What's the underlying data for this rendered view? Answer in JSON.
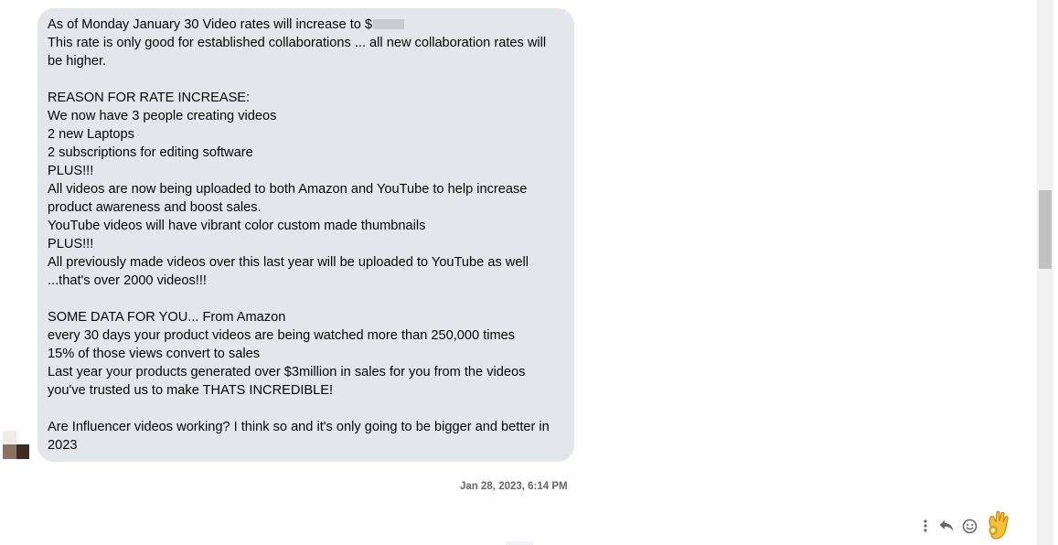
{
  "message": {
    "rate_intro": "As of Monday January 30 Video rates will increase to $",
    "lines": [
      "This rate is only good for established collaborations ... all new collaboration rates will be higher.",
      "",
      "REASON FOR RATE INCREASE:",
      "We now have 3 people creating videos",
      "2 new Laptops",
      "2 subscriptions for editing software",
      "PLUS!!!",
      "All videos are now being uploaded to both Amazon and YouTube to help increase product awareness and boost sales.",
      "YouTube videos will have vibrant color custom made thumbnails",
      "PLUS!!!",
      "All previously made videos over this last year will be uploaded to YouTube as well",
      "...that's over 2000 videos!!!",
      "",
      "SOME DATA FOR YOU... From Amazon",
      "every 30 days your product videos are being watched more than 250,000 times",
      "15% of those views convert to sales",
      "Last year your products generated over $3million in sales for you from the videos you've trusted us to make THATS INCREDIBLE!",
      "",
      "Are Influencer videos working? I think so and it's only going to be bigger and better in 2023"
    ],
    "bubble_color": "#e4e6eb",
    "text_color": "#050505"
  },
  "timestamp": "Jan 28, 2023, 6:14 PM",
  "actions": {
    "more_icon": "vertical-ellipsis",
    "reply_icon": "reply-arrow",
    "react_icon": "smiley-face",
    "reaction": "👌"
  },
  "avatar": {
    "colors": [
      "#f0ece8",
      "#ffffff",
      "#8a7266",
      "#3d2b25"
    ]
  },
  "scrollbar": {
    "position": 0.35
  }
}
